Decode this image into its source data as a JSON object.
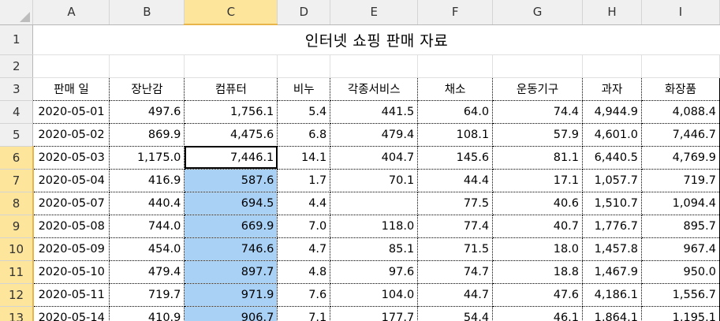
{
  "columns": [
    "A",
    "B",
    "C",
    "D",
    "E",
    "F",
    "G",
    "H",
    "I"
  ],
  "selected_column": "C",
  "title": "인터넷 쇼핑 판매 자료",
  "headers": [
    "판매 일",
    "장난감",
    "컴퓨터",
    "비누",
    "각종서비스",
    "채소",
    "운동기구",
    "과자",
    "화장품"
  ],
  "rows": [
    {
      "num": "4",
      "cells": [
        "2020-05-01",
        "497.6",
        "1,756.1",
        "5.4",
        "441.5",
        "64.0",
        "74.4",
        "4,944.9",
        "4,088.4"
      ]
    },
    {
      "num": "5",
      "cells": [
        "2020-05-02",
        "869.9",
        "4,475.6",
        "6.8",
        "479.4",
        "108.1",
        "57.9",
        "4,601.0",
        "7,446.7"
      ]
    },
    {
      "num": "6",
      "cells": [
        "2020-05-03",
        "1,175.0",
        "7,446.1",
        "14.1",
        "404.7",
        "145.6",
        "81.1",
        "6,440.5",
        "4,769.9"
      ]
    },
    {
      "num": "7",
      "cells": [
        "2020-05-04",
        "416.9",
        "587.6",
        "1.7",
        "70.1",
        "44.4",
        "17.1",
        "1,057.7",
        "719.7"
      ]
    },
    {
      "num": "8",
      "cells": [
        "2020-05-07",
        "440.4",
        "694.5",
        "4.4",
        "",
        "77.5",
        "40.6",
        "1,510.7",
        "1,094.4"
      ]
    },
    {
      "num": "9",
      "cells": [
        "2020-05-08",
        "744.0",
        "669.9",
        "7.0",
        "118.0",
        "77.4",
        "40.7",
        "1,776.7",
        "895.7"
      ]
    },
    {
      "num": "10",
      "cells": [
        "2020-05-09",
        "454.0",
        "746.6",
        "4.7",
        "85.1",
        "71.5",
        "18.0",
        "1,457.8",
        "967.4"
      ]
    },
    {
      "num": "11",
      "cells": [
        "2020-05-10",
        "479.4",
        "897.7",
        "4.8",
        "97.6",
        "74.7",
        "18.8",
        "1,467.9",
        "950.0"
      ]
    },
    {
      "num": "12",
      "cells": [
        "2020-05-11",
        "719.7",
        "971.9",
        "7.6",
        "104.0",
        "44.7",
        "47.6",
        "4,186.1",
        "1,556.7"
      ]
    },
    {
      "num": "13",
      "cells": [
        "2020-05-14",
        "410.9",
        "906.7",
        "7.1",
        "177.7",
        "54.4",
        "46.1",
        "1,864.1",
        "1,195.1"
      ]
    }
  ],
  "row_numbers_top": [
    "1",
    "2",
    "3"
  ],
  "active_cell": "C6",
  "selection_range": "C7:C13",
  "colors": {
    "selection": "#a9d0f5",
    "header_selected": "#fde59c"
  }
}
